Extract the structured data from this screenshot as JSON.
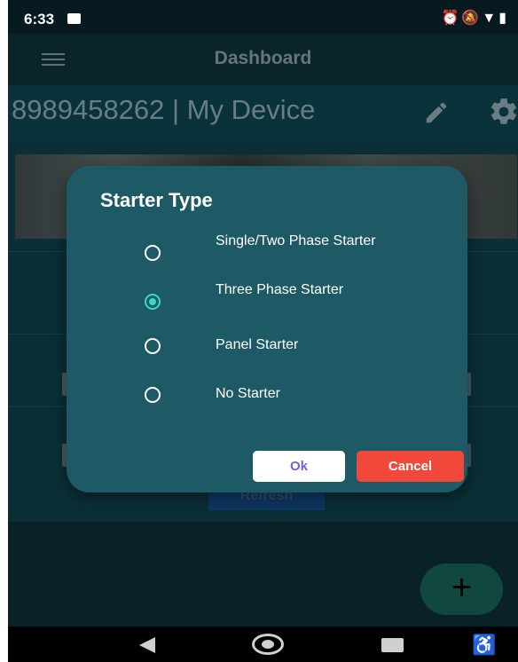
{
  "status_bar": {
    "time": "6:33",
    "icons": [
      "image-icon",
      "alarm-icon",
      "silent-icon",
      "wifi-icon",
      "signal-icon",
      "battery-icon"
    ]
  },
  "app_bar": {
    "title": "Dashboard"
  },
  "device": {
    "title": "8989458262 | My Device"
  },
  "background": {
    "refresh_label": "Refresh",
    "fab_label": "+"
  },
  "dialog": {
    "title": "Starter Type",
    "options": [
      {
        "label": "Single/Two Phase Starter",
        "selected": false
      },
      {
        "label": "Three Phase Starter",
        "selected": true
      },
      {
        "label": "Panel Starter",
        "selected": false
      },
      {
        "label": "No Starter",
        "selected": false
      }
    ],
    "ok_label": "Ok",
    "cancel_label": "Cancel"
  },
  "colors": {
    "dialog_bg": "#1e5a66",
    "radio_selected": "#3dd8c6",
    "ok_text": "#7a5bd6",
    "cancel_bg": "#f0483b",
    "fab_bg": "#14584f"
  }
}
